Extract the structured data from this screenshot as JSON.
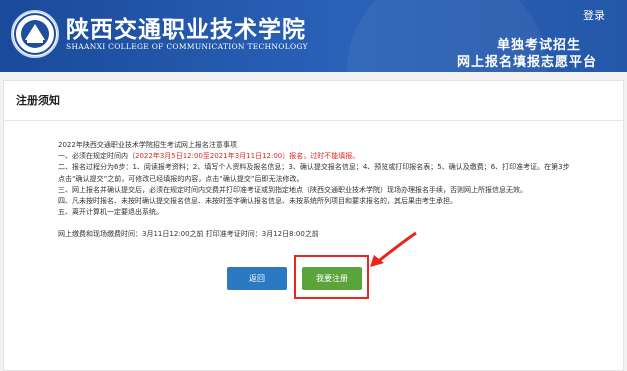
{
  "header": {
    "school_name_cn": "陕西交通职业技术学院",
    "school_name_en": "SHAANXI COLLEGE OF COMMUNICATION TECHNOLOGY",
    "login_label": "登录",
    "slogan_line1": "单独考试招生",
    "slogan_line2": "网上报名填报志愿平台",
    "logo_icon": "school-logo-icon"
  },
  "panel": {
    "title": "注册须知",
    "notice_title": "2022年陕西交通职业技术学院招生考试网上报名注意事项",
    "item1_prefix": "一、必须在规定时间内（",
    "item1_red": "2022年3月5日12:00至2021年3月11日12:00）报名，过时不能填报。",
    "item2_line1": "二、报名过程分为6步：1、阅读报考资料；2、填写个人资料及报名信息；3、确认提交报名信息；4、预览或打印报名表；5、确认及缴费；6、打印准考证。在第3步",
    "item2_line2": "点击“确认提交”之前，可修改已经填报的内容，点击“确认提交”后即无法修改。",
    "item3": "三、网上报名并确认提交后，必须在规定时间内交费并打印准考证或到指定地点（陕西交通职业技术学院）现场办理报名手续，否则网上所报信息无效。",
    "item4": "四、凡未按时报名、未按时确认提交报名信息、未按时签字确认报名信息、未按系统所列项目和要求报名的，其后果由考生承担。",
    "item5": "五、离开计算机一定要退出系统。",
    "deadline_line": "网上缴费和现场缴费时间：3月11日12:00之前 打印准考证时间：3月12日8:00之前",
    "back_label": "返回",
    "register_label": "我要注册"
  },
  "colors": {
    "header_blue": "#2457a8",
    "back_button": "#2b79c3",
    "register_button": "#5ba43c",
    "highlight_red": "#e8261d",
    "notice_red": "#e0251f"
  }
}
